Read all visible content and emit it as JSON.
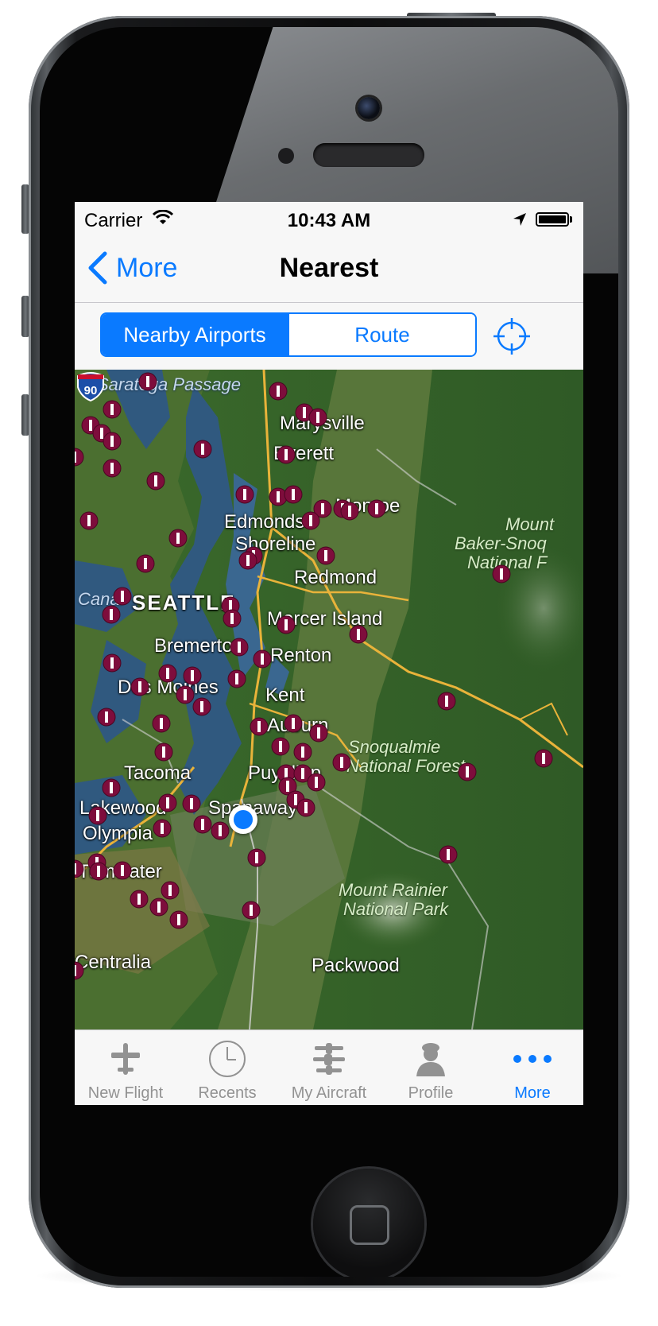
{
  "status_bar": {
    "carrier": "Carrier",
    "time": "10:43 AM"
  },
  "nav": {
    "back_label": "More",
    "title": "Nearest"
  },
  "segments": [
    "Nearby Airports",
    "Route"
  ],
  "map": {
    "places": {
      "saratoga": "Saratoga Passage",
      "marysville": "Marysville",
      "everett": "Everett",
      "monroe": "Monroe",
      "edmonds": "Edmonds",
      "shoreline": "Shoreline",
      "redmond": "Redmond",
      "seattle": "SEATTLE",
      "mercer": "Mercer Island",
      "bremerton": "Bremerton",
      "renton": "Renton",
      "desmoines": "Des Moines",
      "kent": "Kent",
      "auburn": "Auburn",
      "tacoma": "Tacoma",
      "puyallup": "Puyallup",
      "lakewood": "Lakewood",
      "spanaway": "Spanaway",
      "olympia": "Olympia",
      "tumwater": "Tumwater",
      "centralia": "Centralia",
      "packwood": "Packwood",
      "canal": "Canal",
      "snoq1": "Snoqualmie",
      "snoq2": "National Forest",
      "baker1": "Mount",
      "baker2": "Baker-Snoq",
      "baker3": "National F",
      "rainier1": "Mount Rainier",
      "rainier2": "National Park"
    },
    "highway_shield": "90"
  },
  "tabs": [
    {
      "label": "New Flight",
      "icon": "airplane-icon"
    },
    {
      "label": "Recents",
      "icon": "clock-icon"
    },
    {
      "label": "My Aircraft",
      "icon": "aircraft-list-icon"
    },
    {
      "label": "Profile",
      "icon": "pilot-profile-icon"
    },
    {
      "label": "More",
      "icon": "more-dots-icon"
    }
  ],
  "colors": {
    "accent": "#0a7aff",
    "airport_pin": "#7e0d3c"
  }
}
